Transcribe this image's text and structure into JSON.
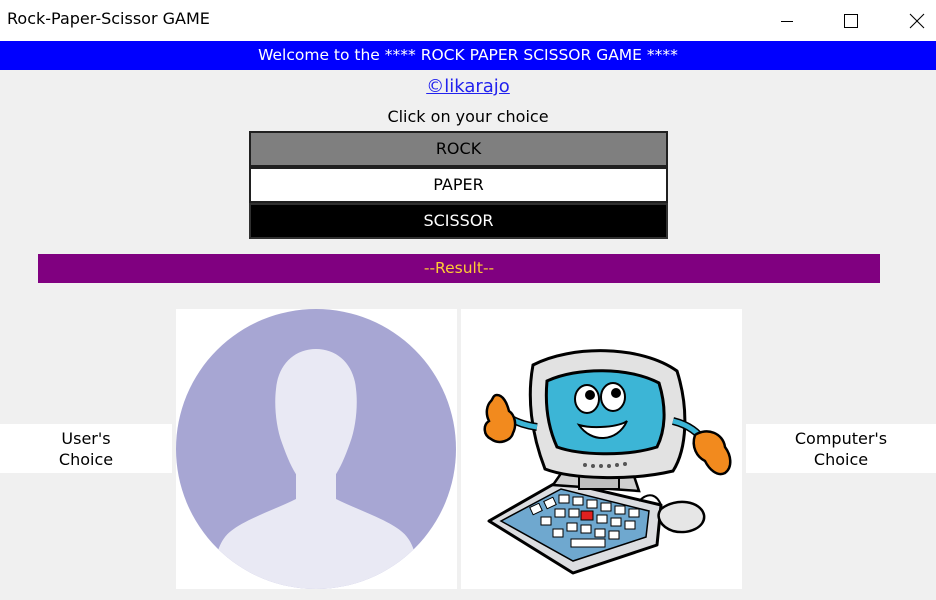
{
  "window": {
    "title": "Rock-Paper-Scissor GAME",
    "controls": [
      "minimize",
      "maximize",
      "close"
    ]
  },
  "banner": {
    "text": "Welcome to the **** ROCK PAPER SCISSOR GAME ****",
    "bg_color": "#0000ff",
    "text_color": "#ffffff"
  },
  "author_link": {
    "text": "©likarajo"
  },
  "prompt": {
    "text": "Click on your choice"
  },
  "choices": [
    {
      "label": "ROCK",
      "bg": "#7f7f7f",
      "fg": "#000000"
    },
    {
      "label": "PAPER",
      "bg": "#ffffff",
      "fg": "#000000"
    },
    {
      "label": "SCISSOR",
      "bg": "#000000",
      "fg": "#ffffff"
    }
  ],
  "result": {
    "text": "--Result--",
    "bg_color": "#800080",
    "text_color": "#ffcc33"
  },
  "user": {
    "label_line1": "User's",
    "label_line2": "Choice",
    "image_icon": "user-silhouette-icon"
  },
  "computer": {
    "label_line1": "Computer's",
    "label_line2": "Choice",
    "image_icon": "cartoon-computer-icon"
  }
}
